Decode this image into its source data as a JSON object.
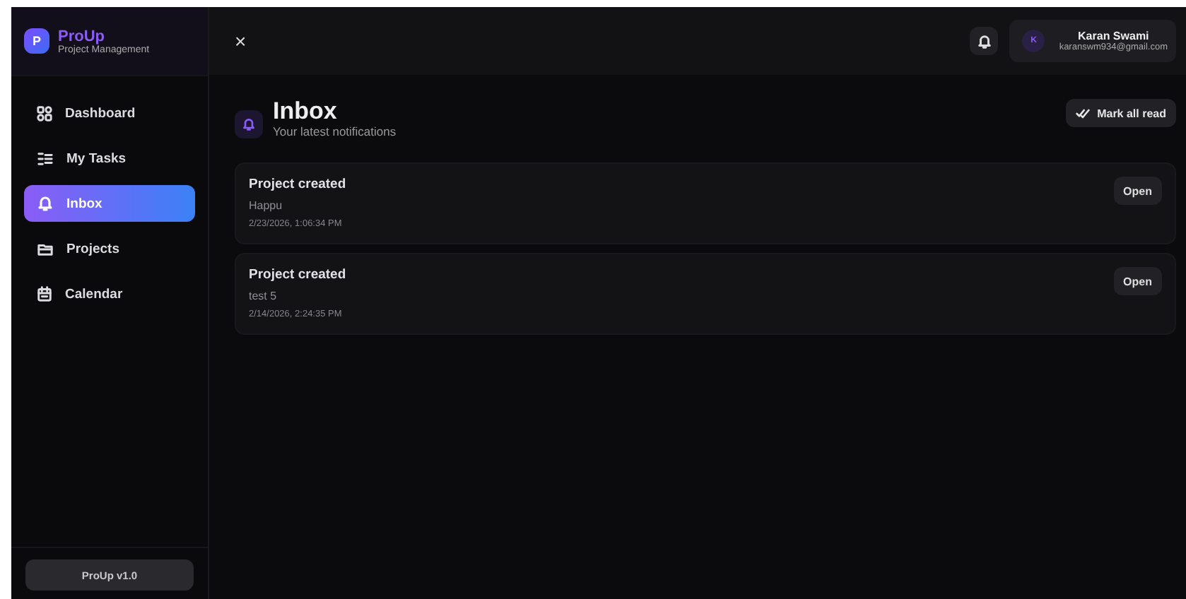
{
  "brand": {
    "logo": "P",
    "name": "ProUp",
    "tagline": "Project Management"
  },
  "sidebar": {
    "items": [
      {
        "label": "Dashboard",
        "selected": false
      },
      {
        "label": "My Tasks",
        "selected": false
      },
      {
        "label": "Inbox",
        "selected": true
      },
      {
        "label": "Projects",
        "selected": false
      },
      {
        "label": "Calendar",
        "selected": false
      }
    ],
    "version": "ProUp v1.0"
  },
  "header": {
    "close": "×",
    "user": {
      "initial": "K",
      "name": "Karan Swami",
      "email": "karanswm934@gmail.com"
    }
  },
  "page": {
    "title": "Inbox",
    "subtitle": "Your latest notifications",
    "action": "Mark all read"
  },
  "notifications": [
    {
      "title": "Project created",
      "body": "Happu",
      "time": "2/23/2026, 1:06:34 PM",
      "action": "Open"
    },
    {
      "title": "Project created",
      "body": "test 5",
      "time": "2/14/2026, 2:24:35 PM",
      "action": "Open"
    }
  ]
}
